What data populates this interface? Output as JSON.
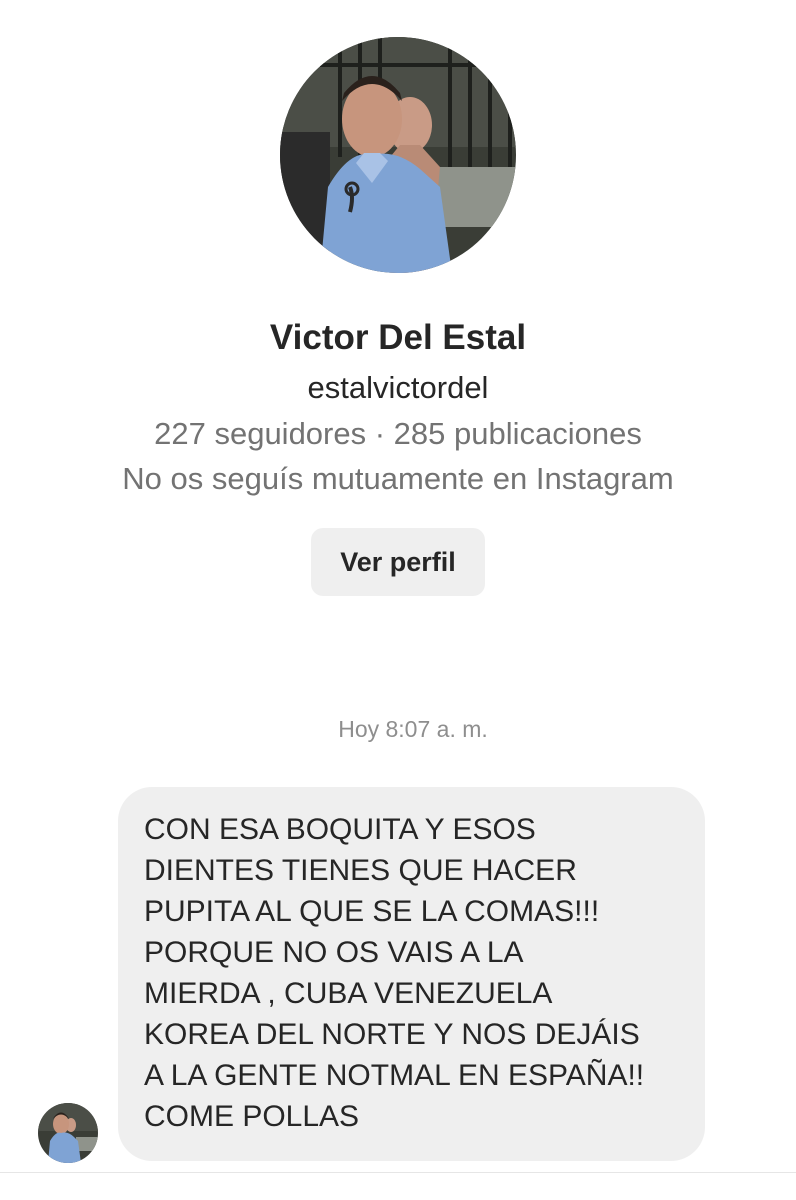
{
  "profile": {
    "display_name": "Victor Del Estal",
    "username": "estalvictordel",
    "stats": "227 seguidores · 285 publicaciones",
    "mutual_status": "No os seguís mutuamente en Instagram",
    "view_profile_label": "Ver perfil",
    "avatar_icon": "profile-photo"
  },
  "thread": {
    "timestamp": "Hoy 8:07 a. m.",
    "message": {
      "lines": [
        "CON ESA BOQUITA Y ESOS",
        "DIENTES TIENES QUE HACER",
        "PUPITA AL QUE SE LA COMAS!!!",
        "PORQUE NO OS VAIS A LA",
        "MIERDA , CUBA VENEZUELA",
        "KOREA DEL NORTE Y NOS DEJÁIS",
        "A LA GENTE NOTMAL EN ESPAÑA!!",
        "COME POLLAS"
      ]
    }
  },
  "colors": {
    "bubble_background": "#efefef",
    "secondary_text": "#737373",
    "primary_text": "#262626"
  }
}
